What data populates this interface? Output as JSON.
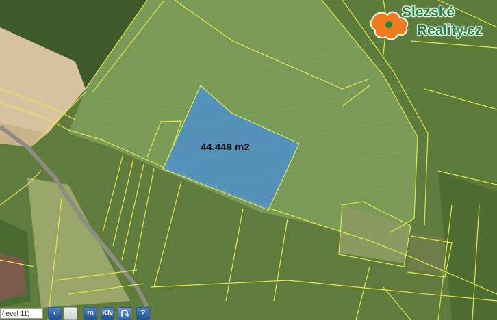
{
  "map": {
    "area_label": "44.449 m2",
    "highlight_color": "#4a8fd6",
    "parcel_line_color": "#e6e84a"
  },
  "logo": {
    "line1": "Slezské",
    "line2": "Reality.cz",
    "text_color": "#1a8a3a",
    "map_shape_color": "#f07a1e"
  },
  "toolbar": {
    "level_text": "(level 11)",
    "back_label": "‹",
    "forward_label": "›",
    "m_label": "m",
    "kn_label": "KN",
    "help_label": "?"
  }
}
